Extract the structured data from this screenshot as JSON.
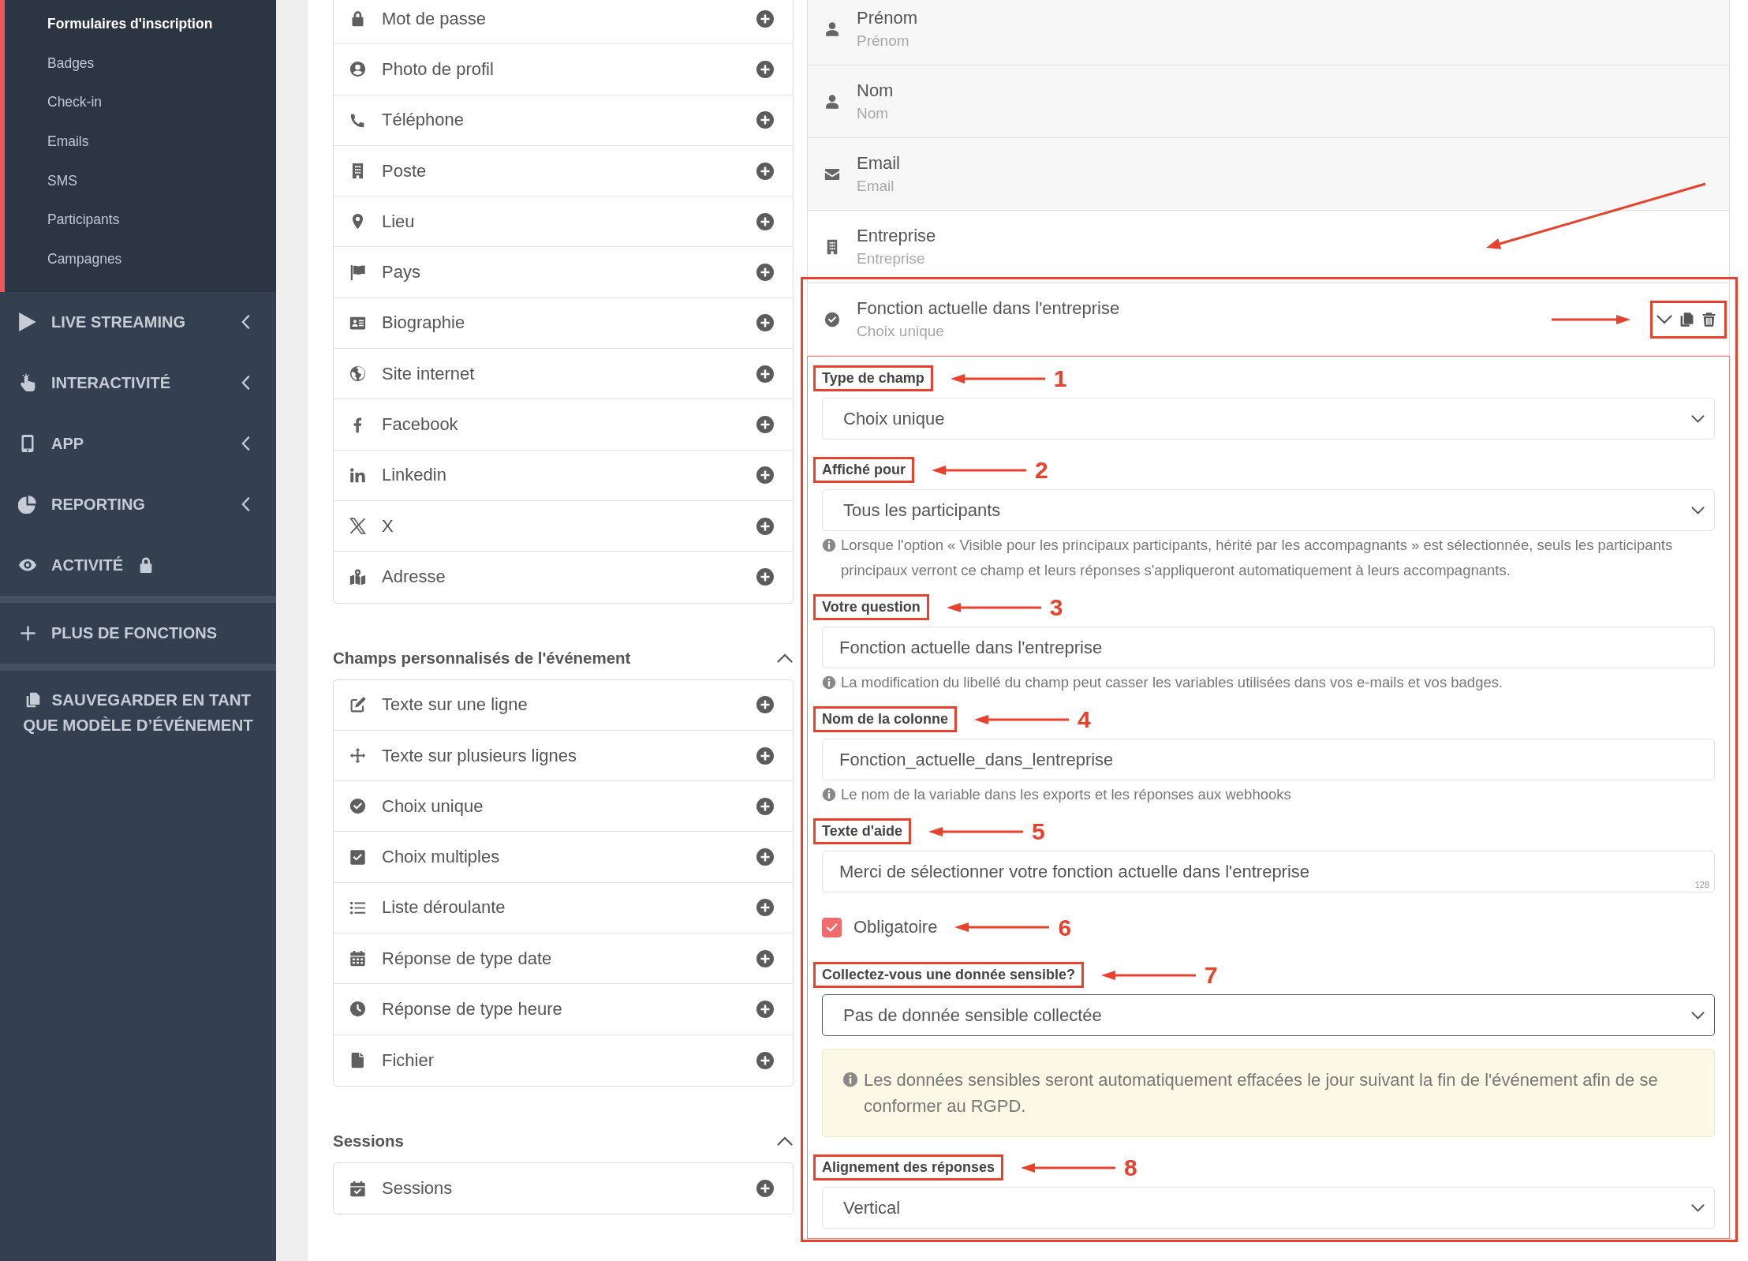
{
  "sidebar": {
    "submenu": [
      {
        "label": "Formulaires d'inscription",
        "selected": true
      },
      {
        "label": "Badges",
        "selected": false
      },
      {
        "label": "Check-in",
        "selected": false
      },
      {
        "label": "Emails",
        "selected": false
      },
      {
        "label": "SMS",
        "selected": false
      },
      {
        "label": "Participants",
        "selected": false
      },
      {
        "label": "Campagnes",
        "selected": false
      }
    ],
    "menu": [
      {
        "label": "LIVE STREAMING",
        "kind": "group",
        "expanded": false
      },
      {
        "label": "INTERACTIVITÉ",
        "kind": "group",
        "expanded": false
      },
      {
        "label": "APP",
        "kind": "group",
        "expanded": false
      },
      {
        "label": "REPORTING",
        "kind": "group",
        "expanded": false
      },
      {
        "label": "ACTIVITÉ",
        "kind": "locked"
      }
    ],
    "more": {
      "label": "PLUS DE FONCTIONS"
    },
    "save_template": {
      "label": "SAUVEGARDER EN TANT QUE MODÈLE D’ÉVÉNEMENT"
    }
  },
  "standard_fields": {
    "items": [
      {
        "label": "Mot de passe"
      },
      {
        "label": "Photo de profil"
      },
      {
        "label": "Téléphone"
      },
      {
        "label": "Poste"
      },
      {
        "label": "Lieu"
      },
      {
        "label": "Pays"
      },
      {
        "label": "Biographie"
      },
      {
        "label": "Site internet"
      },
      {
        "label": "Facebook"
      },
      {
        "label": "Linkedin"
      },
      {
        "label": "X"
      },
      {
        "label": "Adresse"
      }
    ]
  },
  "custom_fields": {
    "title": "Champs personnalisés de l'événement",
    "expanded": true,
    "items": [
      {
        "label": "Texte sur une ligne"
      },
      {
        "label": "Texte sur plusieurs lignes"
      },
      {
        "label": "Choix unique"
      },
      {
        "label": "Choix multiples"
      },
      {
        "label": "Liste déroulante"
      },
      {
        "label": "Réponse de type date"
      },
      {
        "label": "Réponse de type heure"
      },
      {
        "label": "Fichier"
      }
    ]
  },
  "sessions": {
    "title": "Sessions",
    "expanded": true,
    "items": [
      {
        "label": "Sessions"
      }
    ]
  },
  "form": {
    "fields": [
      {
        "title": "Prénom",
        "subtitle": "Prénom",
        "fixed": true,
        "expanded": false,
        "callout_frame": false
      },
      {
        "title": "Nom",
        "subtitle": "Nom",
        "fixed": true,
        "expanded": false,
        "callout_frame": false
      },
      {
        "title": "Email",
        "subtitle": "Email",
        "fixed": true,
        "expanded": false,
        "callout_frame": false
      },
      {
        "title": "Entreprise",
        "subtitle": "Entreprise",
        "fixed": false,
        "expanded": false,
        "callout_frame": false
      },
      {
        "title": "Fonction actuelle dans l'entreprise",
        "subtitle": "Choix unique",
        "fixed": false,
        "expanded": true,
        "callout_frame": true,
        "actions": {
          "callout_frame": true
        },
        "settings": [
          {
            "kind": "select",
            "label": "Type de champ",
            "callout": "1",
            "value": "Choix unique",
            "focused": false
          },
          {
            "kind": "select",
            "label": "Affiché pour",
            "callout": "2",
            "value": "Tous les participants",
            "focused": false,
            "help": "Lorsque l'option « Visible pour les principaux participants, hérité par les accompagnants » est sélectionnée, seuls les participants principaux verront ce champ et leurs réponses s'appliqueront automatiquement à leurs accompagnants."
          },
          {
            "kind": "text",
            "label": "Votre question",
            "callout": "3",
            "value": "Fonction actuelle dans l'entreprise",
            "focused": false,
            "help": "La modification du libellé du champ peut casser les variables utilisées dans vos e-mails et vos badges."
          },
          {
            "kind": "text",
            "label": "Nom de la colonne",
            "callout": "4",
            "value": "Fonction_actuelle_dans_lentreprise",
            "focused": false,
            "help": "Le nom de la variable dans les exports et les réponses aux webhooks"
          },
          {
            "kind": "text",
            "label": "Texte d'aide",
            "callout": "5",
            "value": "Merci de sélectionner votre fonction actuelle dans l'entreprise",
            "focused": false,
            "counter": "128"
          },
          {
            "kind": "checkbox",
            "label": "Obligatoire",
            "callout": "6",
            "checked": true
          },
          {
            "kind": "select",
            "label": "Collectez-vous une donnée sensible?",
            "callout": "7",
            "value": "Pas de donnée sensible collectée",
            "focused": true,
            "notice": "Les données sensibles seront automatiquement effacées le jour suivant la fin de l'événement afin de se conformer au RGPD."
          },
          {
            "kind": "select",
            "label": "Alignement des réponses",
            "callout": "8",
            "value": "Vertical",
            "focused": false
          }
        ]
      }
    ]
  }
}
